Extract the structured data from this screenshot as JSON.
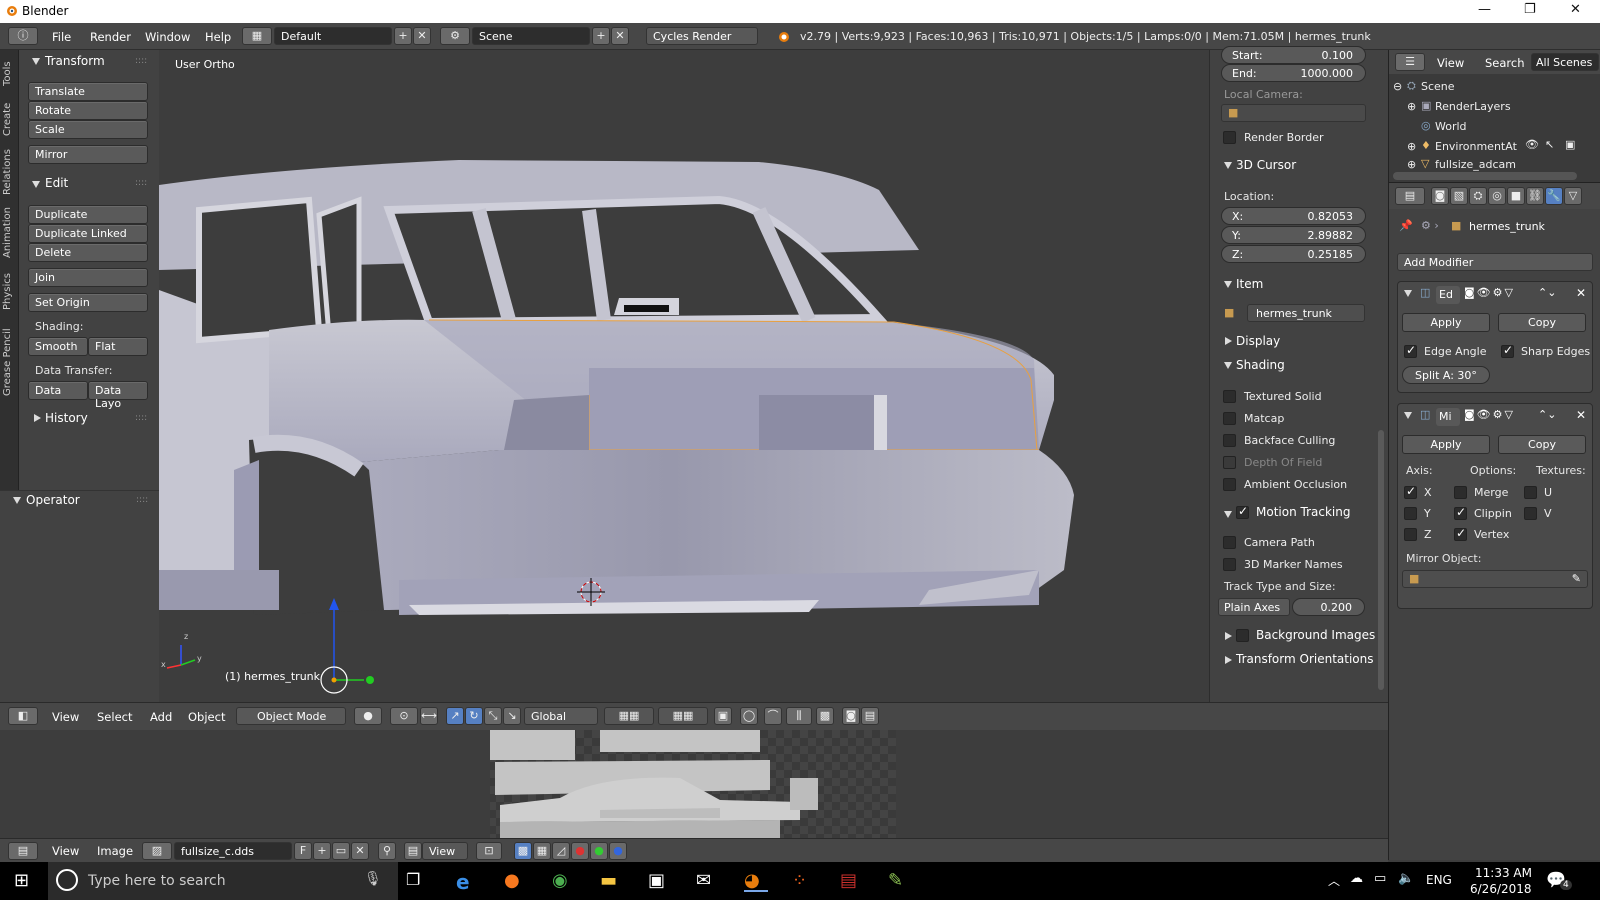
{
  "window": {
    "title": "Blender"
  },
  "infobar": {
    "menus": [
      "File",
      "Render",
      "Window",
      "Help"
    ],
    "screen_layout": "Default",
    "scene": "Scene",
    "engine": "Cycles Render",
    "stats": "v2.79 | Verts:9,923 | Faces:10,963 | Tris:10,971 | Objects:1/5 | Lamps:0/0 | Mem:71.05M | hermes_trunk"
  },
  "tabs": [
    "Tools",
    "Create",
    "Relations",
    "Animation",
    "Physics",
    "Grease Pencil"
  ],
  "toolshelf": {
    "transform": {
      "title": "Transform",
      "buttons": [
        "Translate",
        "Rotate",
        "Scale",
        "Mirror"
      ]
    },
    "edit": {
      "title": "Edit",
      "buttons": [
        "Duplicate",
        "Duplicate Linked",
        "Delete",
        "Join",
        "Set Origin"
      ]
    },
    "shading_label": "Shading:",
    "shading": [
      "Smooth",
      "Flat"
    ],
    "transfer_label": "Data Transfer:",
    "transfer": [
      "Data",
      "Data Layo"
    ],
    "history": "History",
    "operator": "Operator"
  },
  "viewport": {
    "view_label": "User Ortho",
    "object_label": "(1) hermes_trunk",
    "axis_x": "x",
    "axis_y": "y",
    "axis_z": "z"
  },
  "vpheader": {
    "menus": [
      "View",
      "Select",
      "Add",
      "Object"
    ],
    "mode": "Object Mode",
    "orientation": "Global"
  },
  "npanel": {
    "start_label": "Start:",
    "start_value": "0.100",
    "end_label": "End:",
    "end_value": "1000.000",
    "local_camera": "Local Camera:",
    "render_border": "Render Border",
    "cursor_title": "3D Cursor",
    "location_label": "Location:",
    "cursor": [
      {
        "k": "X:",
        "v": "0.82053"
      },
      {
        "k": "Y:",
        "v": "2.89882"
      },
      {
        "k": "Z:",
        "v": "0.25185"
      }
    ],
    "item_title": "Item",
    "item_name": "hermes_trunk",
    "display_title": "Display",
    "shading_title": "Shading",
    "shading_opts": [
      "Textured Solid",
      "Matcap",
      "Backface Culling",
      "Depth Of Field",
      "Ambient Occlusion"
    ],
    "motion_title": "Motion Tracking",
    "motion_opts": [
      "Camera Path",
      "3D Marker Names"
    ],
    "track_label": "Track Type and Size:",
    "track_type": "Plain Axes",
    "track_size": "0.200",
    "bg_images": "Background Images",
    "transform_orient": "Transform Orientations"
  },
  "outliner": {
    "menus": [
      "View",
      "Search"
    ],
    "filter": "All Scenes",
    "items": [
      "Scene",
      "RenderLayers",
      "World",
      "EnvironmentAt",
      "fullsize_adcam"
    ]
  },
  "properties": {
    "object_name": "hermes_trunk",
    "add_modifier": "Add Modifier",
    "mod1": {
      "name": "Ed",
      "apply": "Apply",
      "copy": "Copy",
      "opt1": "Edge Angle",
      "opt2": "Sharp Edges",
      "split": "Split A: 30°"
    },
    "mod2": {
      "name": "Mi",
      "apply": "Apply",
      "copy": "Copy",
      "axis_label": "Axis:",
      "options_label": "Options:",
      "textures_label": "Textures:",
      "axes": [
        "X",
        "Y",
        "Z"
      ],
      "options": [
        "Merge",
        "Clippin",
        "Vertex"
      ],
      "textures": [
        "U",
        "V"
      ],
      "mirror_object": "Mirror Object:"
    }
  },
  "imgheader": {
    "menus": [
      "View",
      "Image"
    ],
    "image_name": "fullsize_c.dds",
    "fake_user": "F",
    "view": "View"
  },
  "taskbar": {
    "search_placeholder": "Type here to search",
    "lang": "ENG",
    "time": "11:33 AM",
    "date": "6/26/2018",
    "notif_count": "4"
  }
}
